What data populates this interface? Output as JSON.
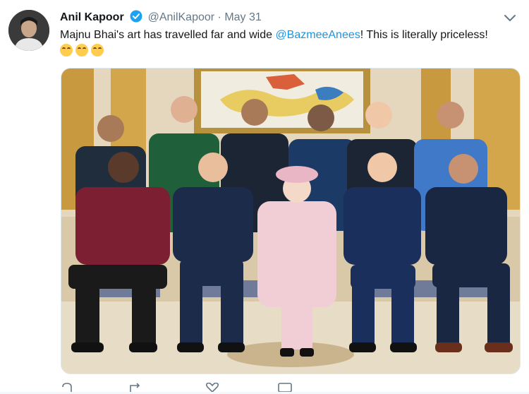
{
  "author": {
    "name": "Anil Kapoor",
    "handle": "@AnilKapoor",
    "separator": "·",
    "date": "May 31"
  },
  "tweet": {
    "text_before": "Majnu Bhai's art has travelled far and wide ",
    "mention": "@BazmeeAnees",
    "text_after": "! This is literally priceless! ",
    "emojis": [
      "face-with-tears-of-joy",
      "face-with-tears-of-joy",
      "face-with-tears-of-joy"
    ]
  },
  "media": {
    "type": "photo",
    "subject": "group-photo"
  },
  "actions": {
    "icons": [
      "reply-icon",
      "retweet-icon",
      "like-icon",
      "message-icon"
    ]
  },
  "colors": {
    "link": "#1b95e0",
    "verified": "#1da1f2",
    "muted": "#657786",
    "text": "#14171a"
  }
}
